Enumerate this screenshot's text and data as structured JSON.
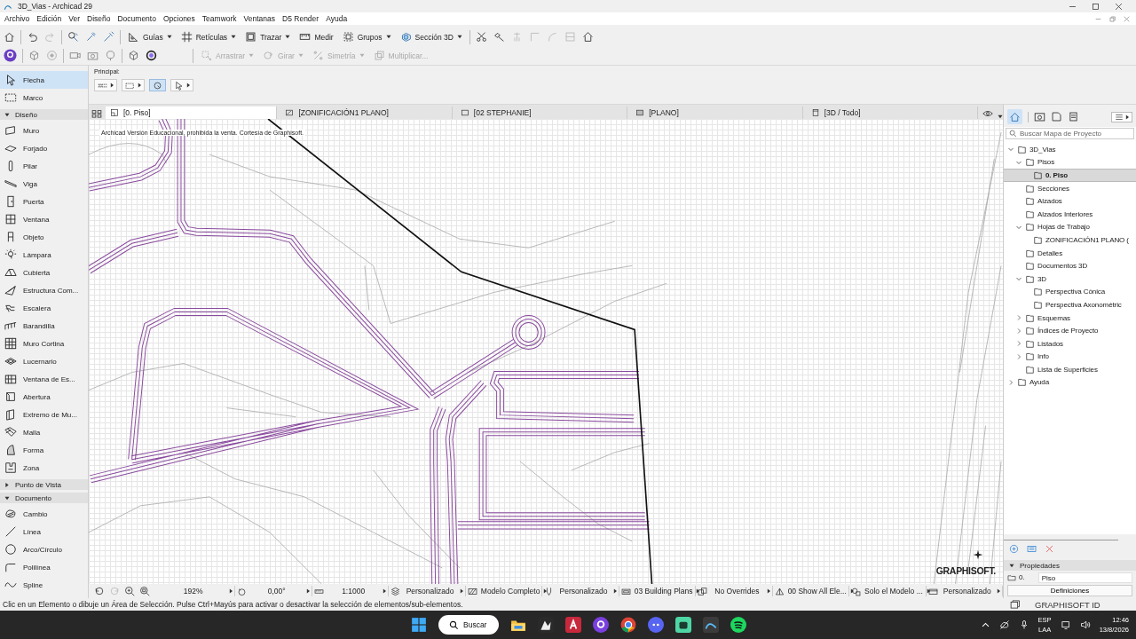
{
  "window": {
    "title": "3D_Vias - Archicad 29"
  },
  "menu": [
    "Archivo",
    "Edición",
    "Ver",
    "Diseño",
    "Documento",
    "Opciones",
    "Teamwork",
    "Ventanas",
    "D5 Render",
    "Ayuda"
  ],
  "toolbar": {
    "row_1": [
      {
        "label": "Guías",
        "dropdown": true,
        "disabled": false
      },
      {
        "label": "Retículas",
        "dropdown": true,
        "disabled": false
      },
      {
        "label": "Trazar",
        "dropdown": true,
        "disabled": false
      },
      {
        "label": "Medir",
        "dropdown": false,
        "disabled": false
      },
      {
        "label": "Grupos",
        "dropdown": true,
        "disabled": false
      },
      {
        "label": "Sección 3D",
        "dropdown": true,
        "disabled": false
      }
    ],
    "row_2": [
      {
        "label": "Arrastrar",
        "dropdown": true,
        "disabled": true
      },
      {
        "label": "Girar",
        "dropdown": true,
        "disabled": true
      },
      {
        "label": "Simetría",
        "dropdown": true,
        "disabled": true
      },
      {
        "label": "Multiplicar...",
        "dropdown": false,
        "disabled": true
      }
    ]
  },
  "toolbox": {
    "items": [
      {
        "label": "Flecha",
        "selected": true
      },
      {
        "label": "Marco",
        "selected": false
      }
    ],
    "groups": [
      {
        "title": "Diseño",
        "expanded": true,
        "items": [
          {
            "label": "Muro",
            "selected": false
          },
          {
            "label": "Forjado",
            "selected": false
          },
          {
            "label": "Pilar",
            "selected": false
          },
          {
            "label": "Viga",
            "selected": false
          },
          {
            "label": "Puerta",
            "selected": false
          },
          {
            "label": "Ventana",
            "selected": false
          },
          {
            "label": "Objeto",
            "selected": false
          },
          {
            "label": "Lámpara",
            "selected": false
          },
          {
            "label": "Cubierta",
            "selected": false
          },
          {
            "label": "Estructura Com...",
            "selected": false
          },
          {
            "label": "Escalera",
            "selected": false
          },
          {
            "label": "Barandilla",
            "selected": false
          },
          {
            "label": "Muro Cortina",
            "selected": false
          },
          {
            "label": "Lucernario",
            "selected": false
          },
          {
            "label": "Ventana de Es...",
            "selected": false
          },
          {
            "label": "Abertura",
            "selected": false
          },
          {
            "label": "Extremo de Mu...",
            "selected": false
          },
          {
            "label": "Malla",
            "selected": false
          },
          {
            "label": "Forma",
            "selected": false
          },
          {
            "label": "Zona",
            "selected": false
          }
        ]
      },
      {
        "title": "Punto de Vista",
        "expanded": false
      },
      {
        "title": "Documento",
        "expanded": true,
        "items": [
          {
            "label": "Cambio",
            "selected": false
          },
          {
            "label": "Línea",
            "selected": false
          },
          {
            "label": "Arco/Círculo",
            "selected": false
          },
          {
            "label": "Polilínea",
            "selected": false
          },
          {
            "label": "Spline",
            "selected": false
          }
        ]
      }
    ]
  },
  "principal": {
    "label": "Principal:",
    "buttons": [
      {
        "selected": false
      },
      {
        "selected": false
      },
      {
        "selected": true
      },
      {
        "selected": false
      }
    ]
  },
  "view_tabs": [
    {
      "label": "[0. Piso]",
      "selected": true
    },
    {
      "label": "[ZONIFICACIÓN1 PLANO]",
      "selected": false
    },
    {
      "label": "[02 STEPHANIE]",
      "selected": false
    },
    {
      "label": "[PLANO]",
      "selected": false
    },
    {
      "label": "[3D / Todo]",
      "selected": false
    }
  ],
  "canvas": {
    "notice": "Archicad Versión Educacional, prohibida la venta. Cortesía de Graphisoft.",
    "logo": "GRAPHISOFT."
  },
  "quick_options": [
    "192%",
    "0,00°",
    "1:1000",
    "Personalizado",
    "Modelo Completo",
    "Personalizado",
    "03 Building Plans",
    "No Overrides",
    "00 Show All Ele...",
    "Solo el Modelo ...",
    "Personalizado"
  ],
  "navigator": {
    "search": {
      "placeholder": "Buscar Mapa de Proyecto"
    },
    "tree": [
      {
        "label": "3D_Vias",
        "expanded": true,
        "selected": false,
        "children": [
          {
            "label": "Pisos",
            "expanded": true,
            "selected": false,
            "children": [
              {
                "label": "0. Piso",
                "selected": true
              }
            ]
          },
          {
            "label": "Secciones",
            "selected": false
          },
          {
            "label": "Alzados",
            "selected": false
          },
          {
            "label": "Alzados Interiores",
            "selected": false
          },
          {
            "label": "Hojas de Trabajo",
            "expanded": true,
            "selected": false,
            "children": [
              {
                "label": "ZONIFICACIÓN1 PLANO (",
                "selected": false
              }
            ]
          },
          {
            "label": "Detalles",
            "selected": false
          },
          {
            "label": "Documentos 3D",
            "selected": false
          },
          {
            "label": "3D",
            "expanded": true,
            "selected": false,
            "children": [
              {
                "label": "Perspectiva Cónica",
                "selected": false
              },
              {
                "label": "Perspectiva Axonométric",
                "selected": false
              }
            ]
          },
          {
            "label": "Esquemas",
            "expanded": false,
            "selected": false
          },
          {
            "label": "Índices de Proyecto",
            "expanded": false,
            "selected": false
          },
          {
            "label": "Listados",
            "expanded": false,
            "selected": false
          },
          {
            "label": "Info",
            "expanded": false,
            "selected": false
          },
          {
            "label": "Lista de Superficies",
            "selected": false
          }
        ]
      },
      {
        "label": "Ayuda",
        "expanded": false,
        "selected": false
      }
    ],
    "properties": {
      "title": "Propiedades",
      "expanded": true,
      "id": "0.",
      "name": "Piso",
      "button": "Definiciones"
    }
  },
  "status_bar": {
    "message": "Clic en un Elemento o dibuje un Área de Selección. Pulse Ctrl+Mayús para activar o desactivar la selección de elementos/sub-elementos.",
    "account": "GRAPHISOFT ID"
  },
  "taskbar": {
    "search": "Buscar",
    "language": "ESP",
    "layout": "LAA",
    "time": "12:46",
    "date": "13/8/2026"
  }
}
